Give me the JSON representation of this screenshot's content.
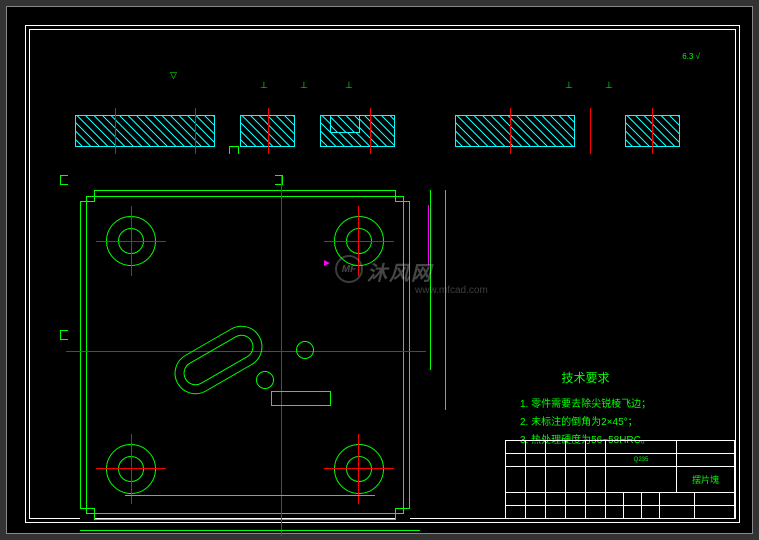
{
  "drawing": {
    "tech_requirements_title": "技术要求",
    "tech_requirements": [
      "1. 零件需要去除尖锐棱飞边；",
      "2. 未标注的倒角为2×45°；",
      "3. 热处理硬度为56~58HRC。"
    ],
    "title_block": {
      "material": "Q235",
      "part_name": "摆片塊"
    },
    "markers": {
      "top_right_1": "6.3",
      "top_right_2": "√"
    },
    "watermark": {
      "text": "沐风网",
      "url": "www.mfcad.com",
      "logo": "MF"
    }
  }
}
